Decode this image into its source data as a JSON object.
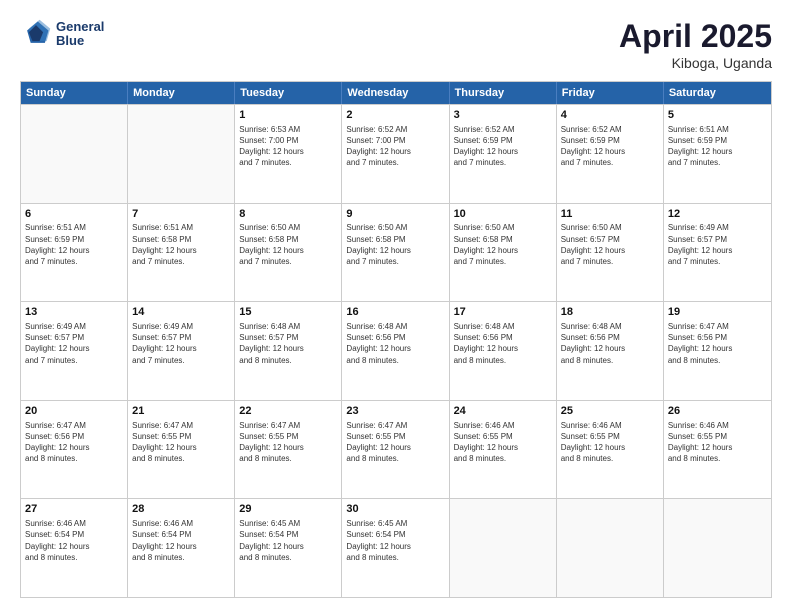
{
  "header": {
    "logo_line1": "General",
    "logo_line2": "Blue",
    "month_year": "April 2025",
    "location": "Kiboga, Uganda"
  },
  "days": [
    "Sunday",
    "Monday",
    "Tuesday",
    "Wednesday",
    "Thursday",
    "Friday",
    "Saturday"
  ],
  "weeks": [
    [
      {
        "date": "",
        "info": ""
      },
      {
        "date": "",
        "info": ""
      },
      {
        "date": "1",
        "info": "Sunrise: 6:53 AM\nSunset: 7:00 PM\nDaylight: 12 hours\nand 7 minutes."
      },
      {
        "date": "2",
        "info": "Sunrise: 6:52 AM\nSunset: 7:00 PM\nDaylight: 12 hours\nand 7 minutes."
      },
      {
        "date": "3",
        "info": "Sunrise: 6:52 AM\nSunset: 6:59 PM\nDaylight: 12 hours\nand 7 minutes."
      },
      {
        "date": "4",
        "info": "Sunrise: 6:52 AM\nSunset: 6:59 PM\nDaylight: 12 hours\nand 7 minutes."
      },
      {
        "date": "5",
        "info": "Sunrise: 6:51 AM\nSunset: 6:59 PM\nDaylight: 12 hours\nand 7 minutes."
      }
    ],
    [
      {
        "date": "6",
        "info": "Sunrise: 6:51 AM\nSunset: 6:59 PM\nDaylight: 12 hours\nand 7 minutes."
      },
      {
        "date": "7",
        "info": "Sunrise: 6:51 AM\nSunset: 6:58 PM\nDaylight: 12 hours\nand 7 minutes."
      },
      {
        "date": "8",
        "info": "Sunrise: 6:50 AM\nSunset: 6:58 PM\nDaylight: 12 hours\nand 7 minutes."
      },
      {
        "date": "9",
        "info": "Sunrise: 6:50 AM\nSunset: 6:58 PM\nDaylight: 12 hours\nand 7 minutes."
      },
      {
        "date": "10",
        "info": "Sunrise: 6:50 AM\nSunset: 6:58 PM\nDaylight: 12 hours\nand 7 minutes."
      },
      {
        "date": "11",
        "info": "Sunrise: 6:50 AM\nSunset: 6:57 PM\nDaylight: 12 hours\nand 7 minutes."
      },
      {
        "date": "12",
        "info": "Sunrise: 6:49 AM\nSunset: 6:57 PM\nDaylight: 12 hours\nand 7 minutes."
      }
    ],
    [
      {
        "date": "13",
        "info": "Sunrise: 6:49 AM\nSunset: 6:57 PM\nDaylight: 12 hours\nand 7 minutes."
      },
      {
        "date": "14",
        "info": "Sunrise: 6:49 AM\nSunset: 6:57 PM\nDaylight: 12 hours\nand 7 minutes."
      },
      {
        "date": "15",
        "info": "Sunrise: 6:48 AM\nSunset: 6:57 PM\nDaylight: 12 hours\nand 8 minutes."
      },
      {
        "date": "16",
        "info": "Sunrise: 6:48 AM\nSunset: 6:56 PM\nDaylight: 12 hours\nand 8 minutes."
      },
      {
        "date": "17",
        "info": "Sunrise: 6:48 AM\nSunset: 6:56 PM\nDaylight: 12 hours\nand 8 minutes."
      },
      {
        "date": "18",
        "info": "Sunrise: 6:48 AM\nSunset: 6:56 PM\nDaylight: 12 hours\nand 8 minutes."
      },
      {
        "date": "19",
        "info": "Sunrise: 6:47 AM\nSunset: 6:56 PM\nDaylight: 12 hours\nand 8 minutes."
      }
    ],
    [
      {
        "date": "20",
        "info": "Sunrise: 6:47 AM\nSunset: 6:56 PM\nDaylight: 12 hours\nand 8 minutes."
      },
      {
        "date": "21",
        "info": "Sunrise: 6:47 AM\nSunset: 6:55 PM\nDaylight: 12 hours\nand 8 minutes."
      },
      {
        "date": "22",
        "info": "Sunrise: 6:47 AM\nSunset: 6:55 PM\nDaylight: 12 hours\nand 8 minutes."
      },
      {
        "date": "23",
        "info": "Sunrise: 6:47 AM\nSunset: 6:55 PM\nDaylight: 12 hours\nand 8 minutes."
      },
      {
        "date": "24",
        "info": "Sunrise: 6:46 AM\nSunset: 6:55 PM\nDaylight: 12 hours\nand 8 minutes."
      },
      {
        "date": "25",
        "info": "Sunrise: 6:46 AM\nSunset: 6:55 PM\nDaylight: 12 hours\nand 8 minutes."
      },
      {
        "date": "26",
        "info": "Sunrise: 6:46 AM\nSunset: 6:55 PM\nDaylight: 12 hours\nand 8 minutes."
      }
    ],
    [
      {
        "date": "27",
        "info": "Sunrise: 6:46 AM\nSunset: 6:54 PM\nDaylight: 12 hours\nand 8 minutes."
      },
      {
        "date": "28",
        "info": "Sunrise: 6:46 AM\nSunset: 6:54 PM\nDaylight: 12 hours\nand 8 minutes."
      },
      {
        "date": "29",
        "info": "Sunrise: 6:45 AM\nSunset: 6:54 PM\nDaylight: 12 hours\nand 8 minutes."
      },
      {
        "date": "30",
        "info": "Sunrise: 6:45 AM\nSunset: 6:54 PM\nDaylight: 12 hours\nand 8 minutes."
      },
      {
        "date": "",
        "info": ""
      },
      {
        "date": "",
        "info": ""
      },
      {
        "date": "",
        "info": ""
      }
    ]
  ]
}
